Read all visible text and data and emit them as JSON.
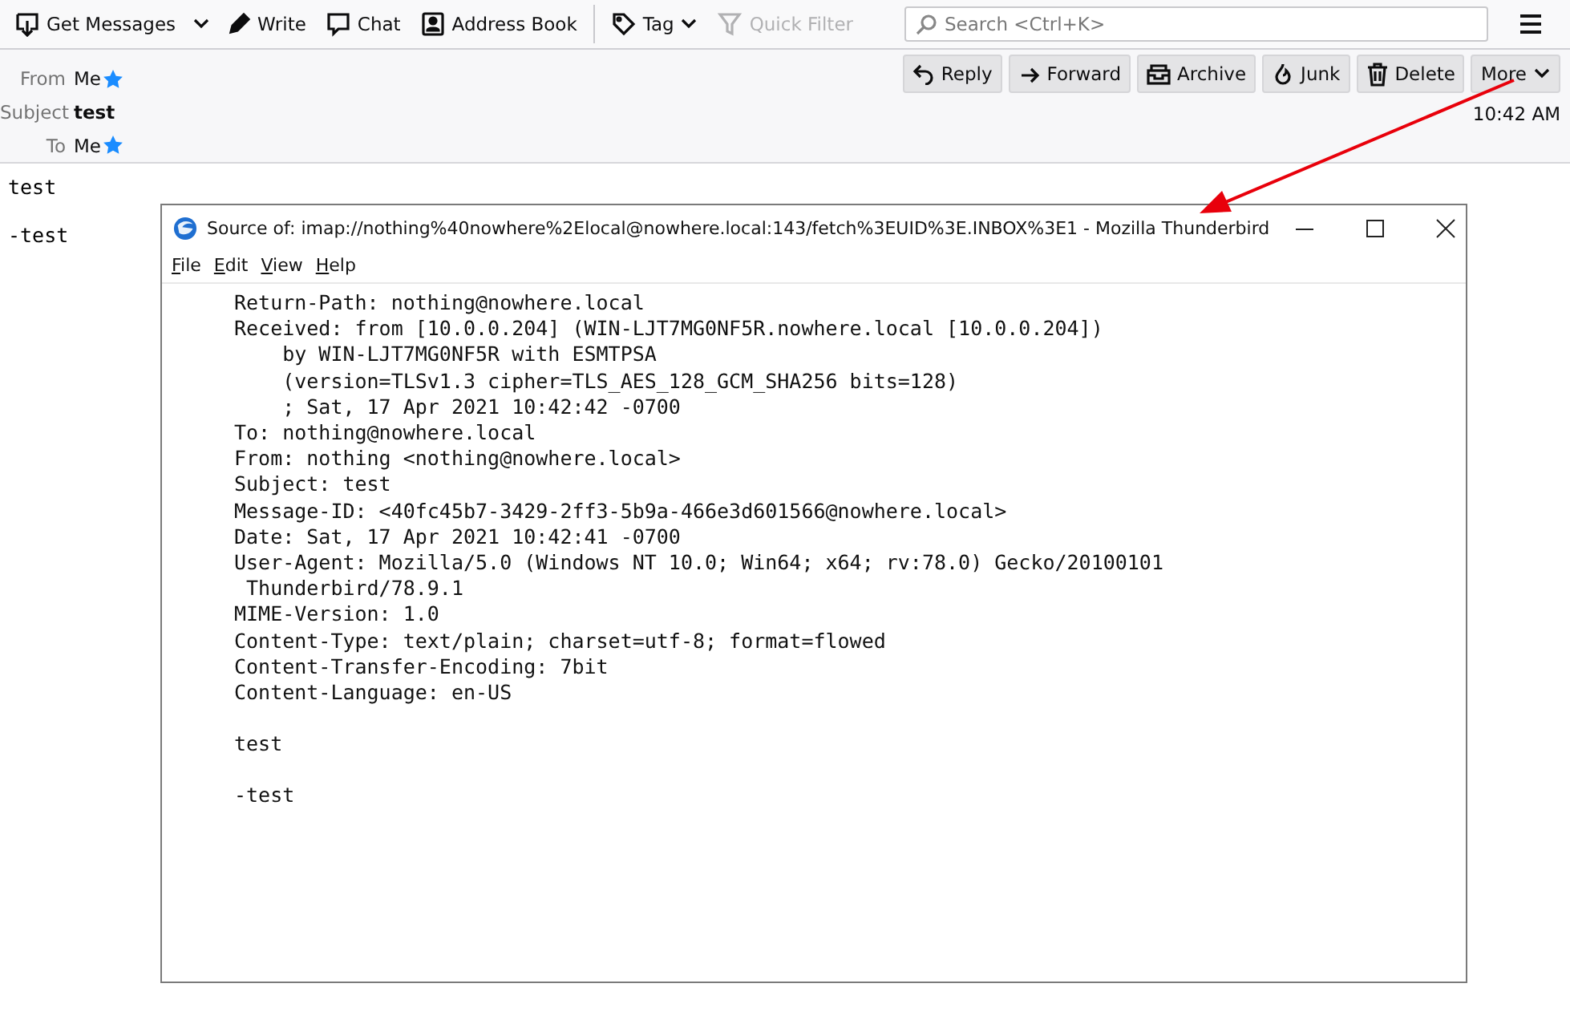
{
  "toolbar": {
    "buttons": [
      {
        "kind": "get",
        "label": "Get Messages"
      },
      {
        "kind": "dropdown"
      },
      {
        "kind": "write",
        "label": "Write"
      },
      {
        "kind": "chat",
        "label": "Chat"
      },
      {
        "kind": "addressbook",
        "label": "Address Book"
      },
      {
        "kind": "separator"
      },
      {
        "kind": "tag",
        "label": "Tag"
      },
      {
        "kind": "filter",
        "label": "Quick Filter",
        "disabled": true
      }
    ],
    "search": {
      "placeholder": "Search <Ctrl+K>"
    }
  },
  "header": {
    "fields": [
      {
        "label": "From",
        "value": "Me",
        "starred": true
      },
      {
        "label": "Subject",
        "value": "test",
        "bold": true
      },
      {
        "label": "To",
        "value": "Me",
        "starred": true
      }
    ],
    "actions": [
      {
        "kind": "reply",
        "label": "Reply"
      },
      {
        "kind": "forward",
        "label": "Forward"
      },
      {
        "kind": "archive",
        "label": "Archive"
      },
      {
        "kind": "junk",
        "label": "Junk"
      },
      {
        "kind": "delete",
        "label": "Delete"
      },
      {
        "kind": "more",
        "label": "More"
      }
    ],
    "time": "10:42 AM"
  },
  "body": [
    "test",
    "-test"
  ],
  "source_window": {
    "title": "Source of: imap://nothing%40nowhere%2Elocal@nowhere.local:143/fetch%3EUID%3E.INBOX%3E1 - Mozilla Thunderbird",
    "menu": [
      "File",
      "Edit",
      "View",
      "Help"
    ],
    "headers": [
      "Return-Path: nothing@nowhere.local",
      "Received: from [10.0.0.204] (WIN-LJT7MG0NF5R.nowhere.local [10.0.0.204])",
      "    by WIN-LJT7MG0NF5R with ESMTPSA",
      "    (version=TLSv1.3 cipher=TLS_AES_128_GCM_SHA256 bits=128)",
      "    ; Sat, 17 Apr 2021 10:42:42 -0700",
      "To: nothing@nowhere.local",
      "From: nothing <nothing@nowhere.local>",
      "Subject: test",
      "Message-ID: <40fc45b7-3429-2ff3-5b9a-466e3d601566@nowhere.local>",
      "Date: Sat, 17 Apr 2021 10:42:41 -0700",
      "User-Agent: Mozilla/5.0 (Windows NT 10.0; Win64; x64; rv:78.0) Gecko/20100101",
      " Thunderbird/78.9.1",
      "MIME-Version: 1.0",
      "Content-Type: text/plain; charset=utf-8; format=flowed",
      "Content-Transfer-Encoding: 7bit",
      "Content-Language: en-US"
    ],
    "body": [
      "test",
      "-test"
    ]
  }
}
